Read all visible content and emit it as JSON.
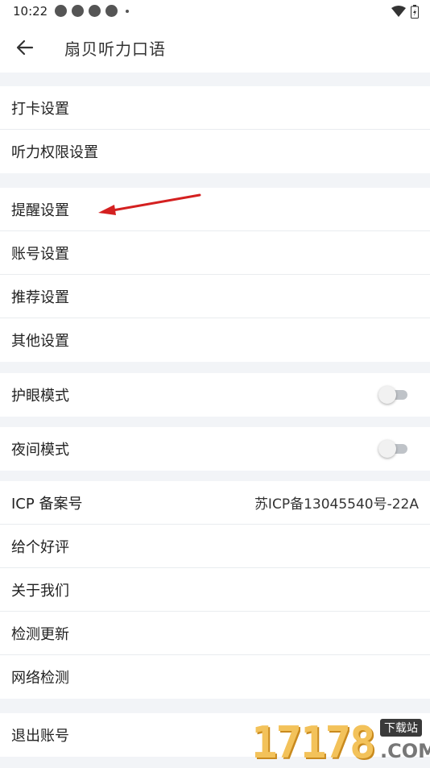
{
  "status_bar": {
    "time": "10:22"
  },
  "app_bar": {
    "title": "扇贝听力口语"
  },
  "groups": {
    "g1": [
      "打卡设置",
      "听力权限设置"
    ],
    "g2": [
      "提醒设置",
      "账号设置",
      "推荐设置",
      "其他设置"
    ]
  },
  "eye_mode": {
    "label": "护眼模式",
    "on": false
  },
  "night_mode": {
    "label": "夜间模式",
    "on": false
  },
  "icp": {
    "label": "ICP 备案号",
    "value": "苏ICP备13045540号-22A"
  },
  "misc": [
    "给个好评",
    "关于我们",
    "检测更新",
    "网络检测"
  ],
  "logout": "退出账号",
  "watermark": {
    "digits": "17178",
    "tag": "下载站",
    "suffix": ".COM"
  },
  "colors": {
    "annotation_arrow": "#d42020",
    "toggle_off": "#bfc3c8"
  }
}
